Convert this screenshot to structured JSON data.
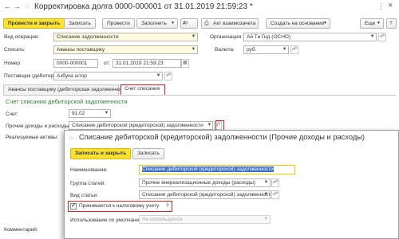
{
  "window": {
    "title": "Корректировка долга 0000-000001 от 31.01.2019 21:59:23 *",
    "more_label": "⋮",
    "close_label": "×"
  },
  "toolbar": {
    "post_close": "Провести и закрыть",
    "save": "Записать",
    "post": "Провести",
    "fill": "Заполнить",
    "act": "Акт взаимозачета",
    "create_basis": "Создать на основании",
    "more": "Еще",
    "help": "?"
  },
  "form": {
    "op_type_label": "Вид операции:",
    "op_type_value": "Списание задолженности",
    "write_off_label": "Списать:",
    "write_off_value": "Авансы поставщику",
    "org_label": "Организация:",
    "org_value": "Ай Ти Гид (ОСНО)",
    "currency_label": "Валюта:",
    "currency_value": "руб.",
    "number_label": "Номер:",
    "number_value": "0000-000001",
    "date_label": "от:",
    "date_value": "31.01.2019 21:59:23",
    "debtor_label": "Поставщик (дебитор):",
    "debtor_value": "Азбука штор"
  },
  "tabs": {
    "tab1": "Авансы поставщику (дебиторская задолженность)",
    "tab2": "Счет списания"
  },
  "panel": {
    "section_title": "Счет списания дебиторской задолженности",
    "account_label": "Счет:",
    "account_value": "91.02",
    "other_label": "Прочие доходы и расходы:",
    "other_value": "Списание дебиторской (кредиторской) задолженности",
    "assets_label": "Реализуемые активы:"
  },
  "comment_label": "Комментарий:",
  "dialog": {
    "title": "Списание дебиторской (кредиторской) задолженности (Прочие доходы и расходы)",
    "save_close": "Записать и закрыть",
    "save": "Записать",
    "more": "Еще",
    "help": "?",
    "name_label": "Наименование:",
    "name_value": "Списание дебиторской (кредиторской) задолженности",
    "group_label": "Группа статей:",
    "group_value": "Прочие внереализационные доходы (расходы)",
    "kind_label": "Вид статьи:",
    "kind_value": "Списание дебиторской (кредиторской) задолженности",
    "tax_label": "Принимается к налоговому учету",
    "tax_help": "?",
    "default_label": "Использование по умолчанию:",
    "default_value": "Не используется"
  }
}
